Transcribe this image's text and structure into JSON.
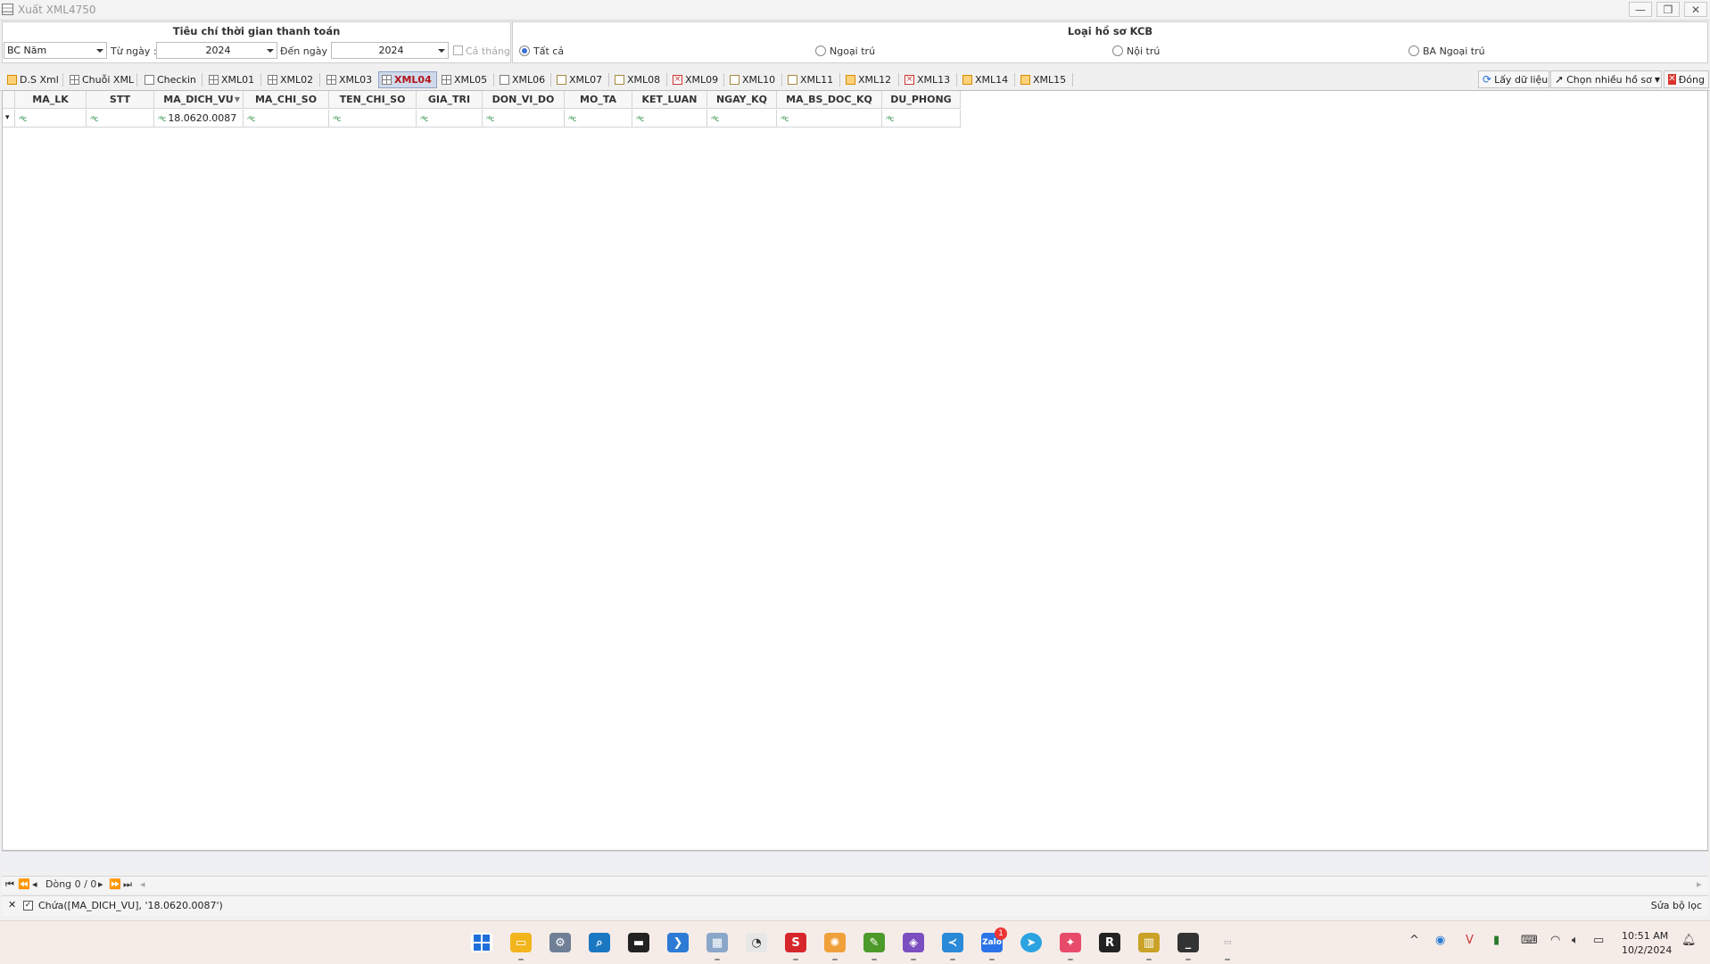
{
  "window": {
    "title": "Xuất XML4750",
    "minimize": "—",
    "restore": "❐",
    "close": "✕"
  },
  "payment_time": {
    "title": "Tiêu chí thời gian thanh toán",
    "report_type": "BC Năm",
    "from_label": "Từ ngày :",
    "from_value": "2024",
    "to_label": "Đến ngày :",
    "to_value": "2024",
    "whole_month": "Cả tháng"
  },
  "record_type": {
    "title": "Loại hồ sơ KCB",
    "options": [
      "Tất cả",
      "Ngoại trú",
      "Nội trú",
      "BA Ngoại trú"
    ],
    "selected": "Tất cả"
  },
  "tabs": [
    "D.S Xml",
    "Chuỗi XML",
    "Checkin",
    "XML01",
    "XML02",
    "XML03",
    "XML04",
    "XML05",
    "XML06",
    "XML07",
    "XML08",
    "XML09",
    "XML10",
    "XML11",
    "XML12",
    "XML13",
    "XML14",
    "XML15"
  ],
  "active_tab": "XML04",
  "actions": {
    "load": "Lấy dữ liệu",
    "multi": "Chọn nhiều hồ sơ",
    "close": "Đóng"
  },
  "grid": {
    "columns": [
      "MA_LK",
      "STT",
      "MA_DICH_VU",
      "MA_CHI_SO",
      "TEN_CHI_SO",
      "GIA_TRI",
      "DON_VI_DO",
      "MO_TA",
      "KET_LUAN",
      "NGAY_KQ",
      "MA_BS_DOC_KQ",
      "DU_PHONG"
    ],
    "filter_row": {
      "MA_DICH_VU": "18.0620.0087"
    },
    "filter_icon": "ᴬᴮc"
  },
  "navigator": {
    "first": "⏮",
    "prev_page": "⏪",
    "prev": "◂",
    "record": "Dòng 0 / 0",
    "next": "▸",
    "next_page": "⏩",
    "last": "⏭"
  },
  "filter": {
    "close": "✕",
    "expression": "Chứa([MA_DICH_VU], '18.0620.0087')",
    "edit": "Sửa bộ lọc"
  },
  "taskbar": {
    "zalo_badge": "1",
    "clock_time": "10:51 AM",
    "clock_date": "10/2/2024",
    "accent": "#1e6fd9"
  }
}
